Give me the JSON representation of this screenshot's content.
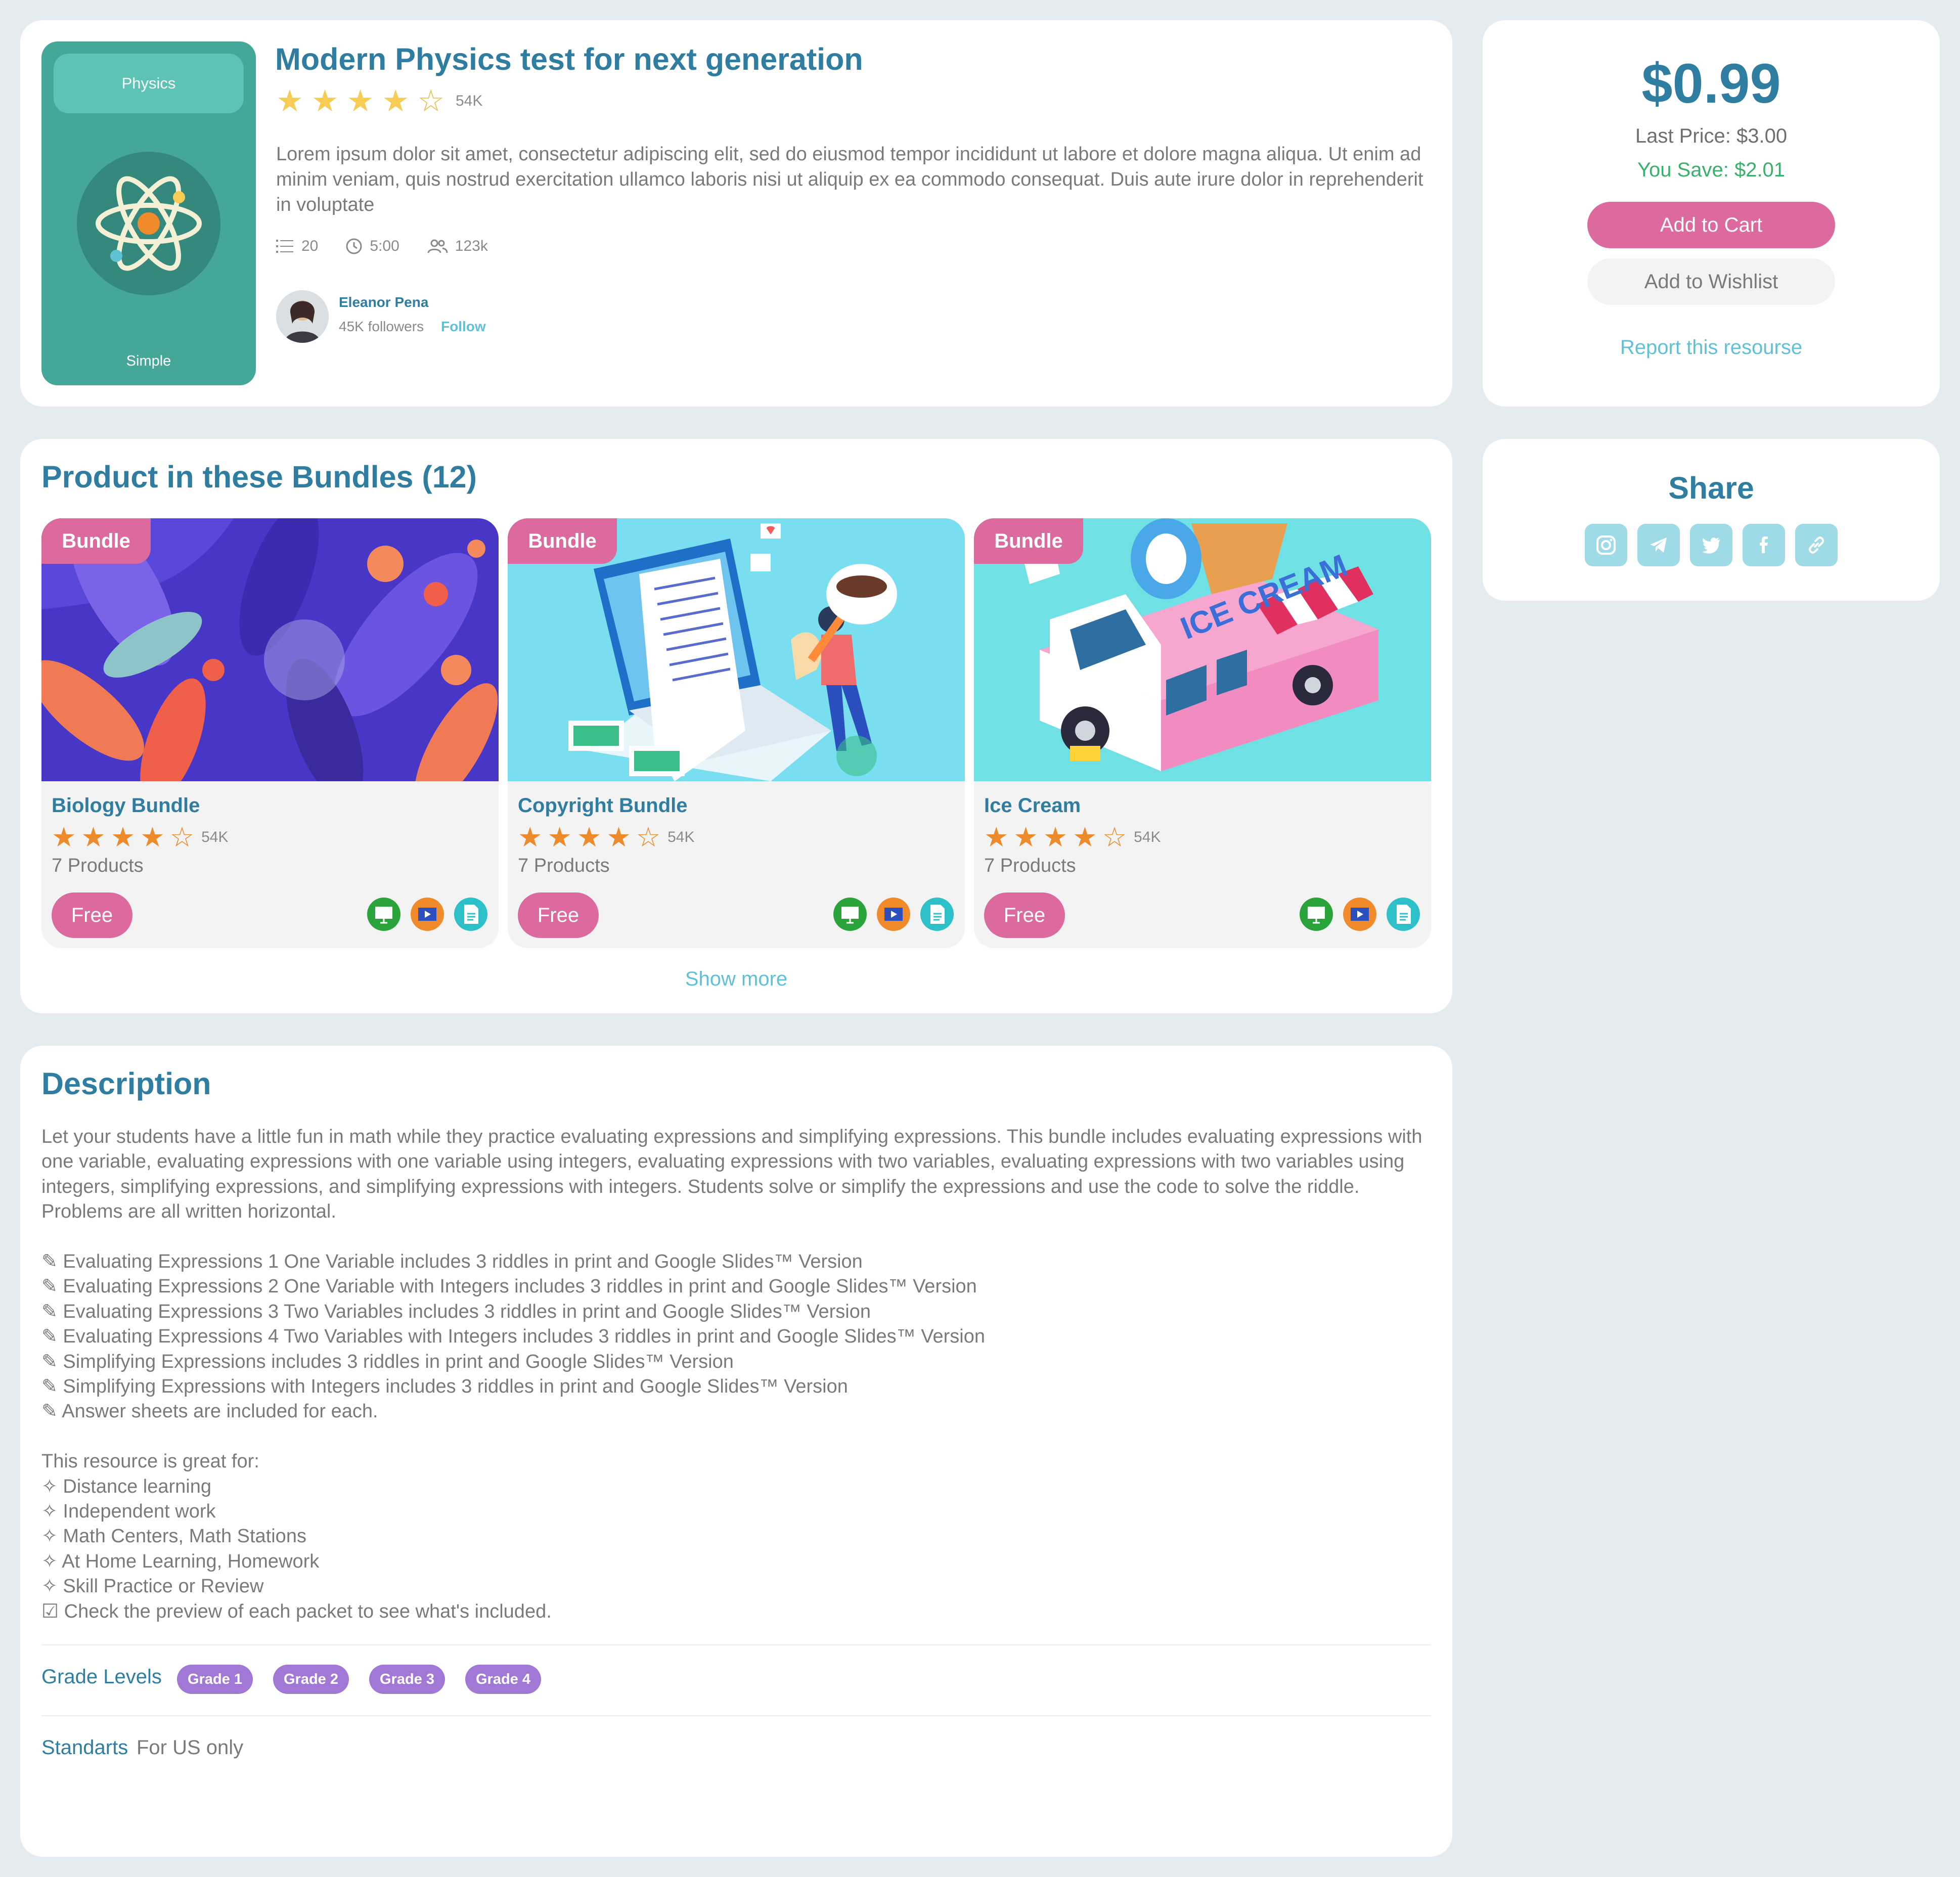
{
  "product": {
    "thumb_subject": "Physics",
    "thumb_level": "Simple",
    "title": "Modern Physics test for next generation",
    "rating": 4,
    "rating_count": "54K",
    "summary": "Lorem ipsum dolor sit amet, consectetur adipiscing elit, sed do eiusmod tempor incididunt ut labore et dolore magna aliqua. Ut enim ad minim veniam, quis nostrud exercitation ullamco laboris nisi ut aliquip ex ea commodo consequat. Duis aute irure dolor in reprehenderit in voluptate",
    "meta": {
      "items": "20",
      "duration": "5:00",
      "learners": "123k"
    },
    "author": {
      "name": "Eleanor Pena",
      "followers": "45K followers",
      "follow_label": "Follow"
    }
  },
  "pricing": {
    "price": "$0.99",
    "last_price": "Last Price: $3.00",
    "you_save": "You Save: $2.01",
    "add_to_cart": "Add to Cart",
    "add_to_wishlist": "Add to Wishlist",
    "report": "Report this resourse"
  },
  "share": {
    "title": "Share",
    "icons": [
      "instagram-icon",
      "telegram-icon",
      "twitter-icon",
      "facebook-icon",
      "link-icon"
    ]
  },
  "bundles": {
    "title": "Product in these Bundles (12)",
    "tag": "Bundle",
    "items": [
      {
        "name": "Biology Bundle",
        "rating": 4,
        "count": "54K",
        "products": "7 Products",
        "price": "Free"
      },
      {
        "name": "Copyright Bundle",
        "rating": 4,
        "count": "54K",
        "products": "7 Products",
        "price": "Free"
      },
      {
        "name": "Ice Cream",
        "rating": 4,
        "count": "54K",
        "products": "7 Products",
        "price": "Free"
      }
    ],
    "format_icons": [
      "presentation-icon",
      "video-icon",
      "document-icon"
    ],
    "show_more": "Show more"
  },
  "description": {
    "title": "Description",
    "intro": "Let your students have a little fun in math while they practice evaluating expressions and simplifying expressions. This bundle includes evaluating expressions with one variable, evaluating expressions with one variable using integers, evaluating expressions with two variables, evaluating expressions with two variables using integers, simplifying expressions, and simplifying expressions with integers. Students solve or simplify the expressions and use the code to solve the riddle. Problems are all written horizontal.",
    "list": [
      "✎ Evaluating Expressions 1 One Variable includes 3 riddles in print and Google Slides™ Version",
      "✎ Evaluating Expressions 2 One Variable with Integers includes 3 riddles in print and Google Slides™ Version",
      "✎ Evaluating Expressions 3 Two Variables includes 3 riddles in print and Google Slides™ Version",
      "✎ Evaluating Expressions 4 Two Variables with Integers includes 3 riddles in print and Google Slides™ Version",
      "✎ Simplifying Expressions includes 3 riddles in print and Google Slides™ Version",
      "✎ Simplifying Expressions with Integers includes 3 riddles in print and Google Slides™ Version",
      "✎ Answer sheets are included for each."
    ],
    "great_for_title": "This resource is great for:",
    "great_for": [
      "✧ Distance learning",
      "✧ Independent work",
      "✧ Math Centers, Math Stations",
      "✧ At Home Learning, Homework",
      "✧ Skill Practice or Review",
      "☑ Check the preview of each packet to see what's included."
    ],
    "grade_levels_label": "Grade Levels",
    "grades": [
      "Grade 1",
      "Grade 2",
      "Grade 3",
      "Grade 4"
    ],
    "standards_label": "Standarts",
    "standards_value": "For US only"
  },
  "colors": {
    "heading": "#2f7da0",
    "accent_pink": "#dc6a9e",
    "teal_link": "#5ec2d6",
    "save_green": "#39b16a",
    "grade_purple": "#a178d6"
  }
}
